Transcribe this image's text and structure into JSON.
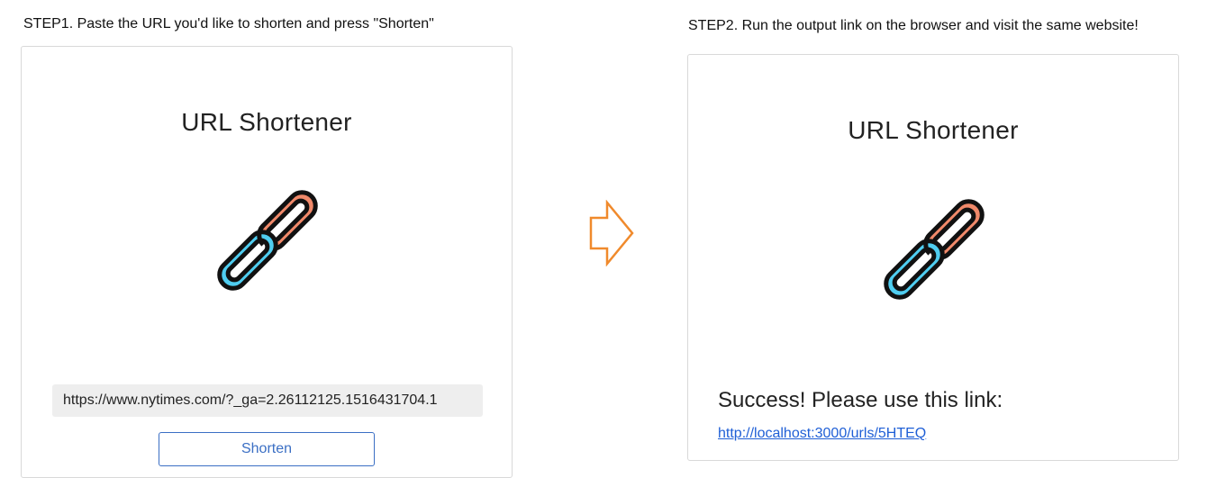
{
  "step1": {
    "label": "STEP1. Paste the URL you'd like to shorten and press \"Shorten\"",
    "card": {
      "title": "URL Shortener",
      "logo_icon": "chain-link-icon",
      "url_input_value": "https://www.nytimes.com/?_ga=2.26112125.1516431704.1",
      "shorten_button_label": "Shorten"
    }
  },
  "step2": {
    "label": "STEP2. Run the output link on the browser and visit the same website!",
    "card": {
      "title": "URL Shortener",
      "logo_icon": "chain-link-icon",
      "success_message": "Success! Please use this link:",
      "result_link": "http://localhost:3000/urls/5HTEQ"
    }
  },
  "transition_icon": "arrow-right-icon",
  "colors": {
    "chain_orange": "#f0896a",
    "chain_blue": "#4fcdf0",
    "outline": "#111111",
    "arrow": "#f08a2c",
    "button_blue": "#3b6fc4",
    "link_blue": "#1f5fd6"
  }
}
